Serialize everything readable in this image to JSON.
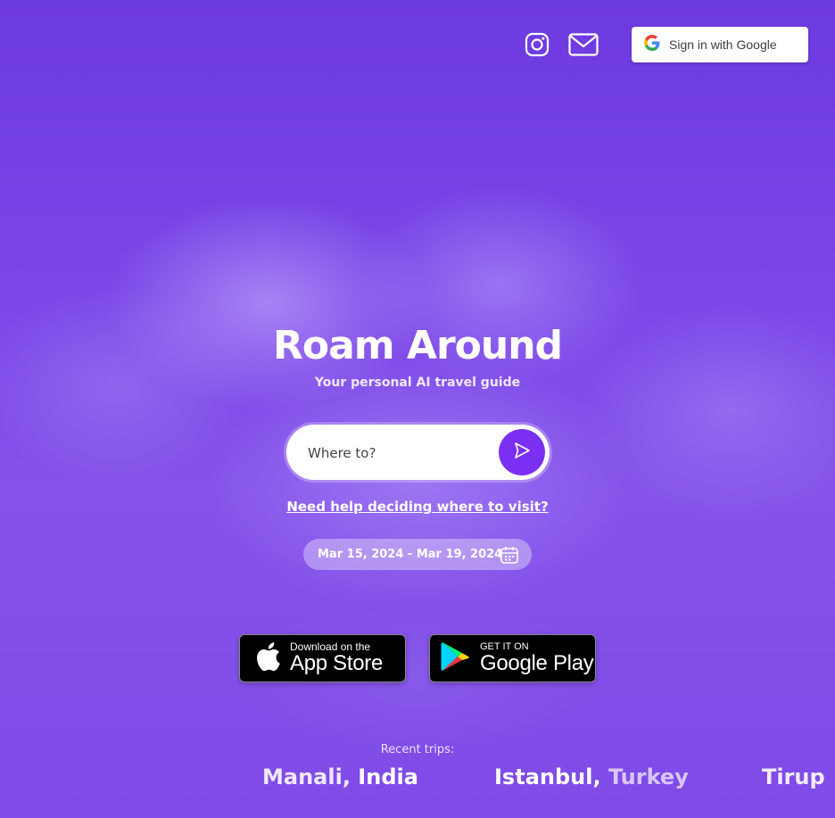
{
  "header": {
    "instagram_icon": "instagram-icon",
    "mail_icon": "mail-icon",
    "google_button_label": "Sign in with Google"
  },
  "hero": {
    "title": "Roam Around",
    "subtitle": "Your personal AI travel guide"
  },
  "search": {
    "placeholder": "Where to?",
    "value": "",
    "submit_icon": "send-icon"
  },
  "help_link": "Need help deciding where to visit?",
  "date_range": {
    "label": "Mar 15, 2024 - Mar 19, 2024",
    "icon": "calendar-icon"
  },
  "stores": {
    "apple": {
      "small": "Download on the",
      "big": "App Store"
    },
    "google": {
      "small": "GET IT ON",
      "big": "Google Play"
    }
  },
  "recent": {
    "label": "Recent trips:",
    "trips": [
      {
        "city": "Manali,",
        "country": "India"
      },
      {
        "city": "Istanbul,",
        "country": "Turkey"
      },
      {
        "text": "Tirup"
      }
    ]
  },
  "colors": {
    "background": "#7a45e6",
    "accent_button": "#7b2ff2",
    "white": "#ffffff"
  }
}
